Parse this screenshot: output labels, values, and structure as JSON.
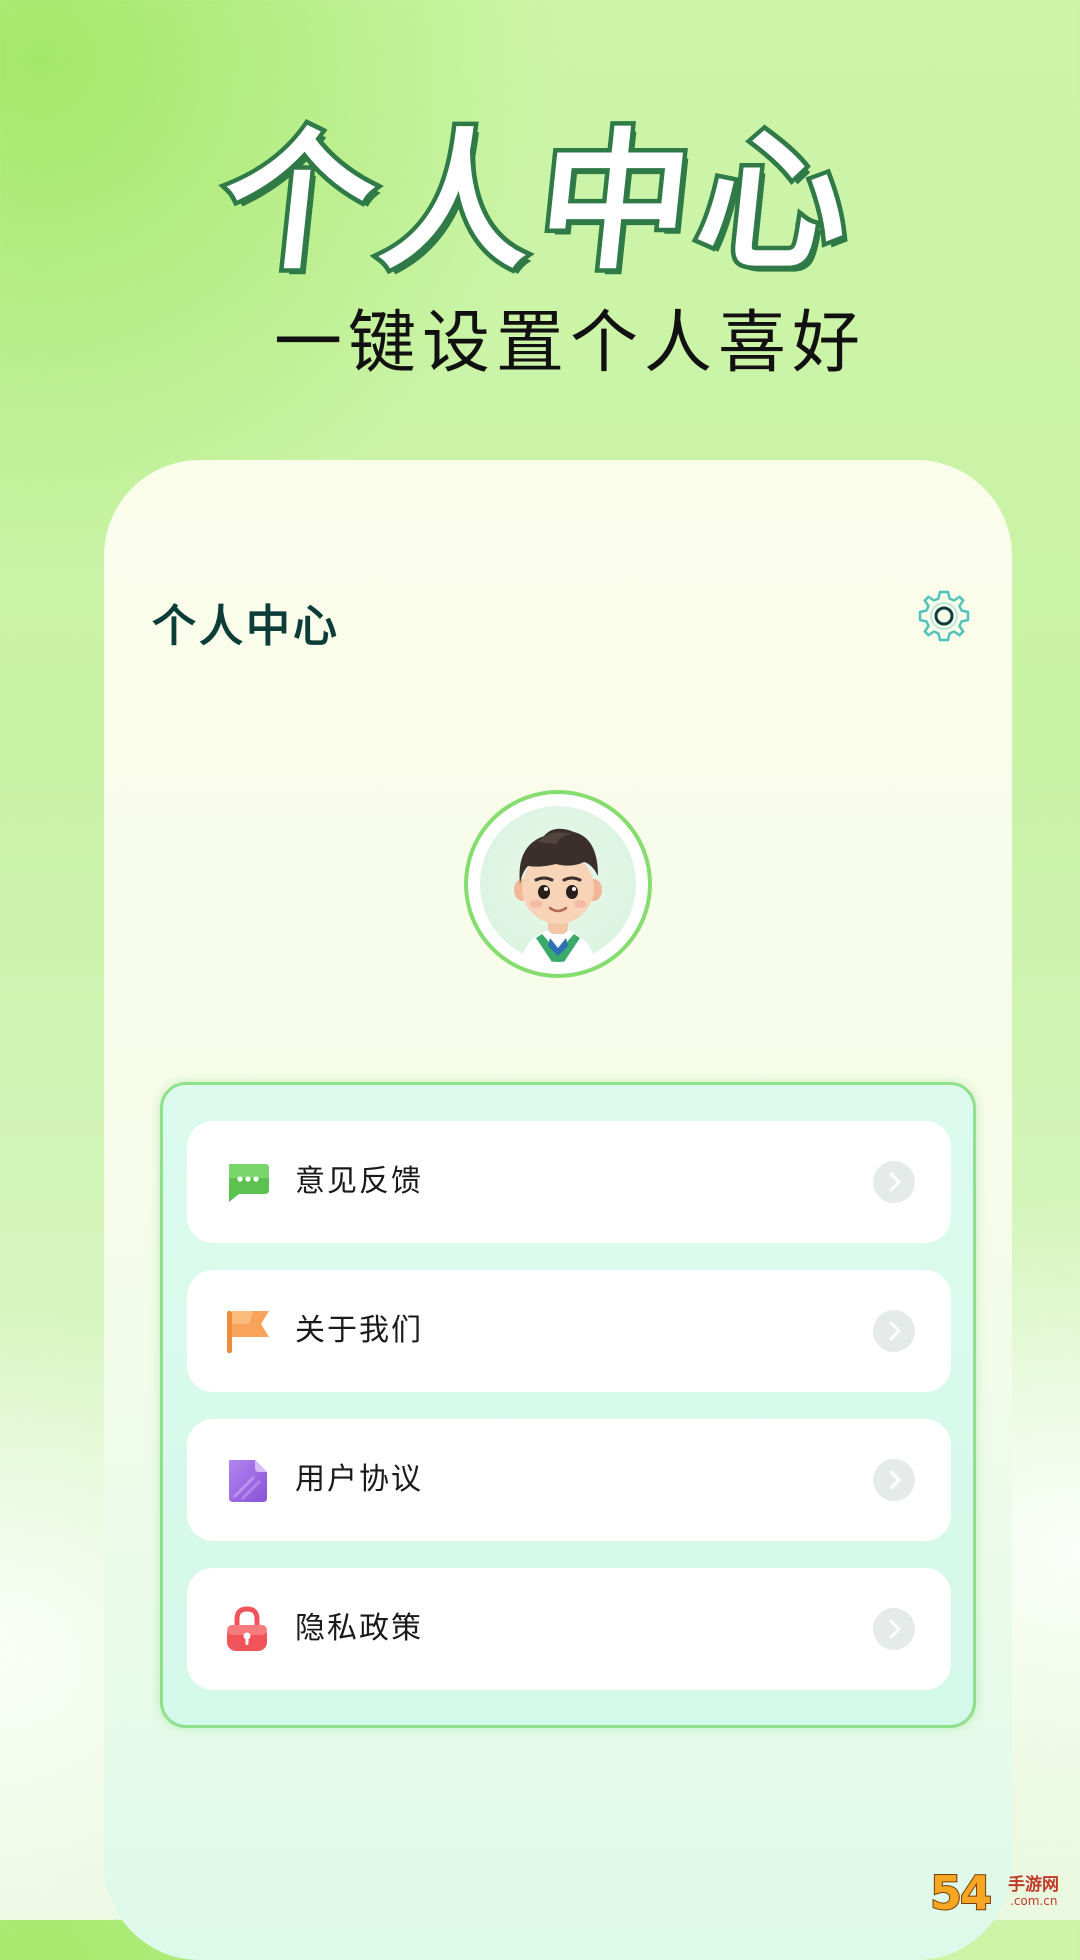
{
  "hero": {
    "title": "个人中心",
    "subtitle": "一键设置个人喜好"
  },
  "screen": {
    "title": "个人中心",
    "settings_icon": "gear-icon",
    "avatar": "cartoon-boy-avatar"
  },
  "menu": {
    "items": [
      {
        "label": "意见反馈",
        "icon": "chat-bubble-icon",
        "color": "#5cc24f"
      },
      {
        "label": "关于我们",
        "icon": "flag-icon",
        "color": "#f59a4a"
      },
      {
        "label": "用户协议",
        "icon": "document-icon",
        "color": "#9b63e0"
      },
      {
        "label": "隐私政策",
        "icon": "lock-icon",
        "color": "#f0535a"
      }
    ]
  },
  "watermark": {
    "number": "54",
    "site_name": "手游网",
    "url": ".com.cn"
  },
  "colors": {
    "accent_green": "#2f7a46",
    "title_dark": "#0d3d38",
    "panel_border": "#8fe08a"
  }
}
